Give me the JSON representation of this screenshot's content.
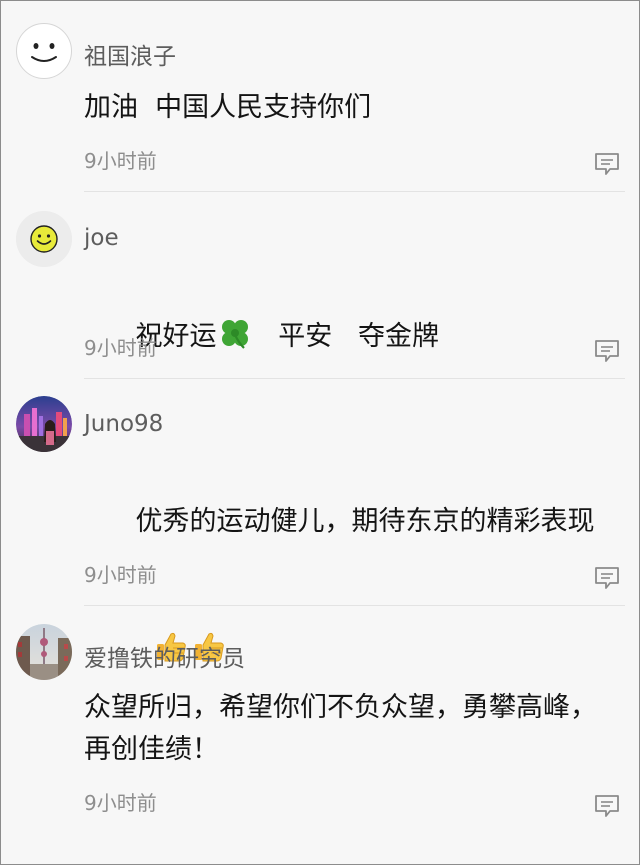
{
  "comments": [
    {
      "username": "祖国浪子",
      "text": "加油  中国人民支持你们",
      "time": "9小时前"
    },
    {
      "username": "joe",
      "text_before_emoji": "祝好运",
      "emoji": "four-leaf-clover",
      "text_after_emoji": "   平安   夺金牌",
      "time": "9小时前"
    },
    {
      "username": "Juno98",
      "text": "优秀的运动健儿，期待东京的精彩表现",
      "emojis": [
        "thumbs-up",
        "thumbs-up"
      ],
      "time": "9小时前"
    },
    {
      "username": "爱撸铁的研究员",
      "text": "众望所归，希望你们不负众望，勇攀高峰，再创佳绩！",
      "time": "9小时前"
    }
  ],
  "icons": {
    "reply": "comment-bubble-icon"
  },
  "colors": {
    "background": "#f7f7f7",
    "username": "#5d5d5d",
    "text": "#141414",
    "time": "#8e8e8e",
    "divider": "#e3e3e3"
  }
}
